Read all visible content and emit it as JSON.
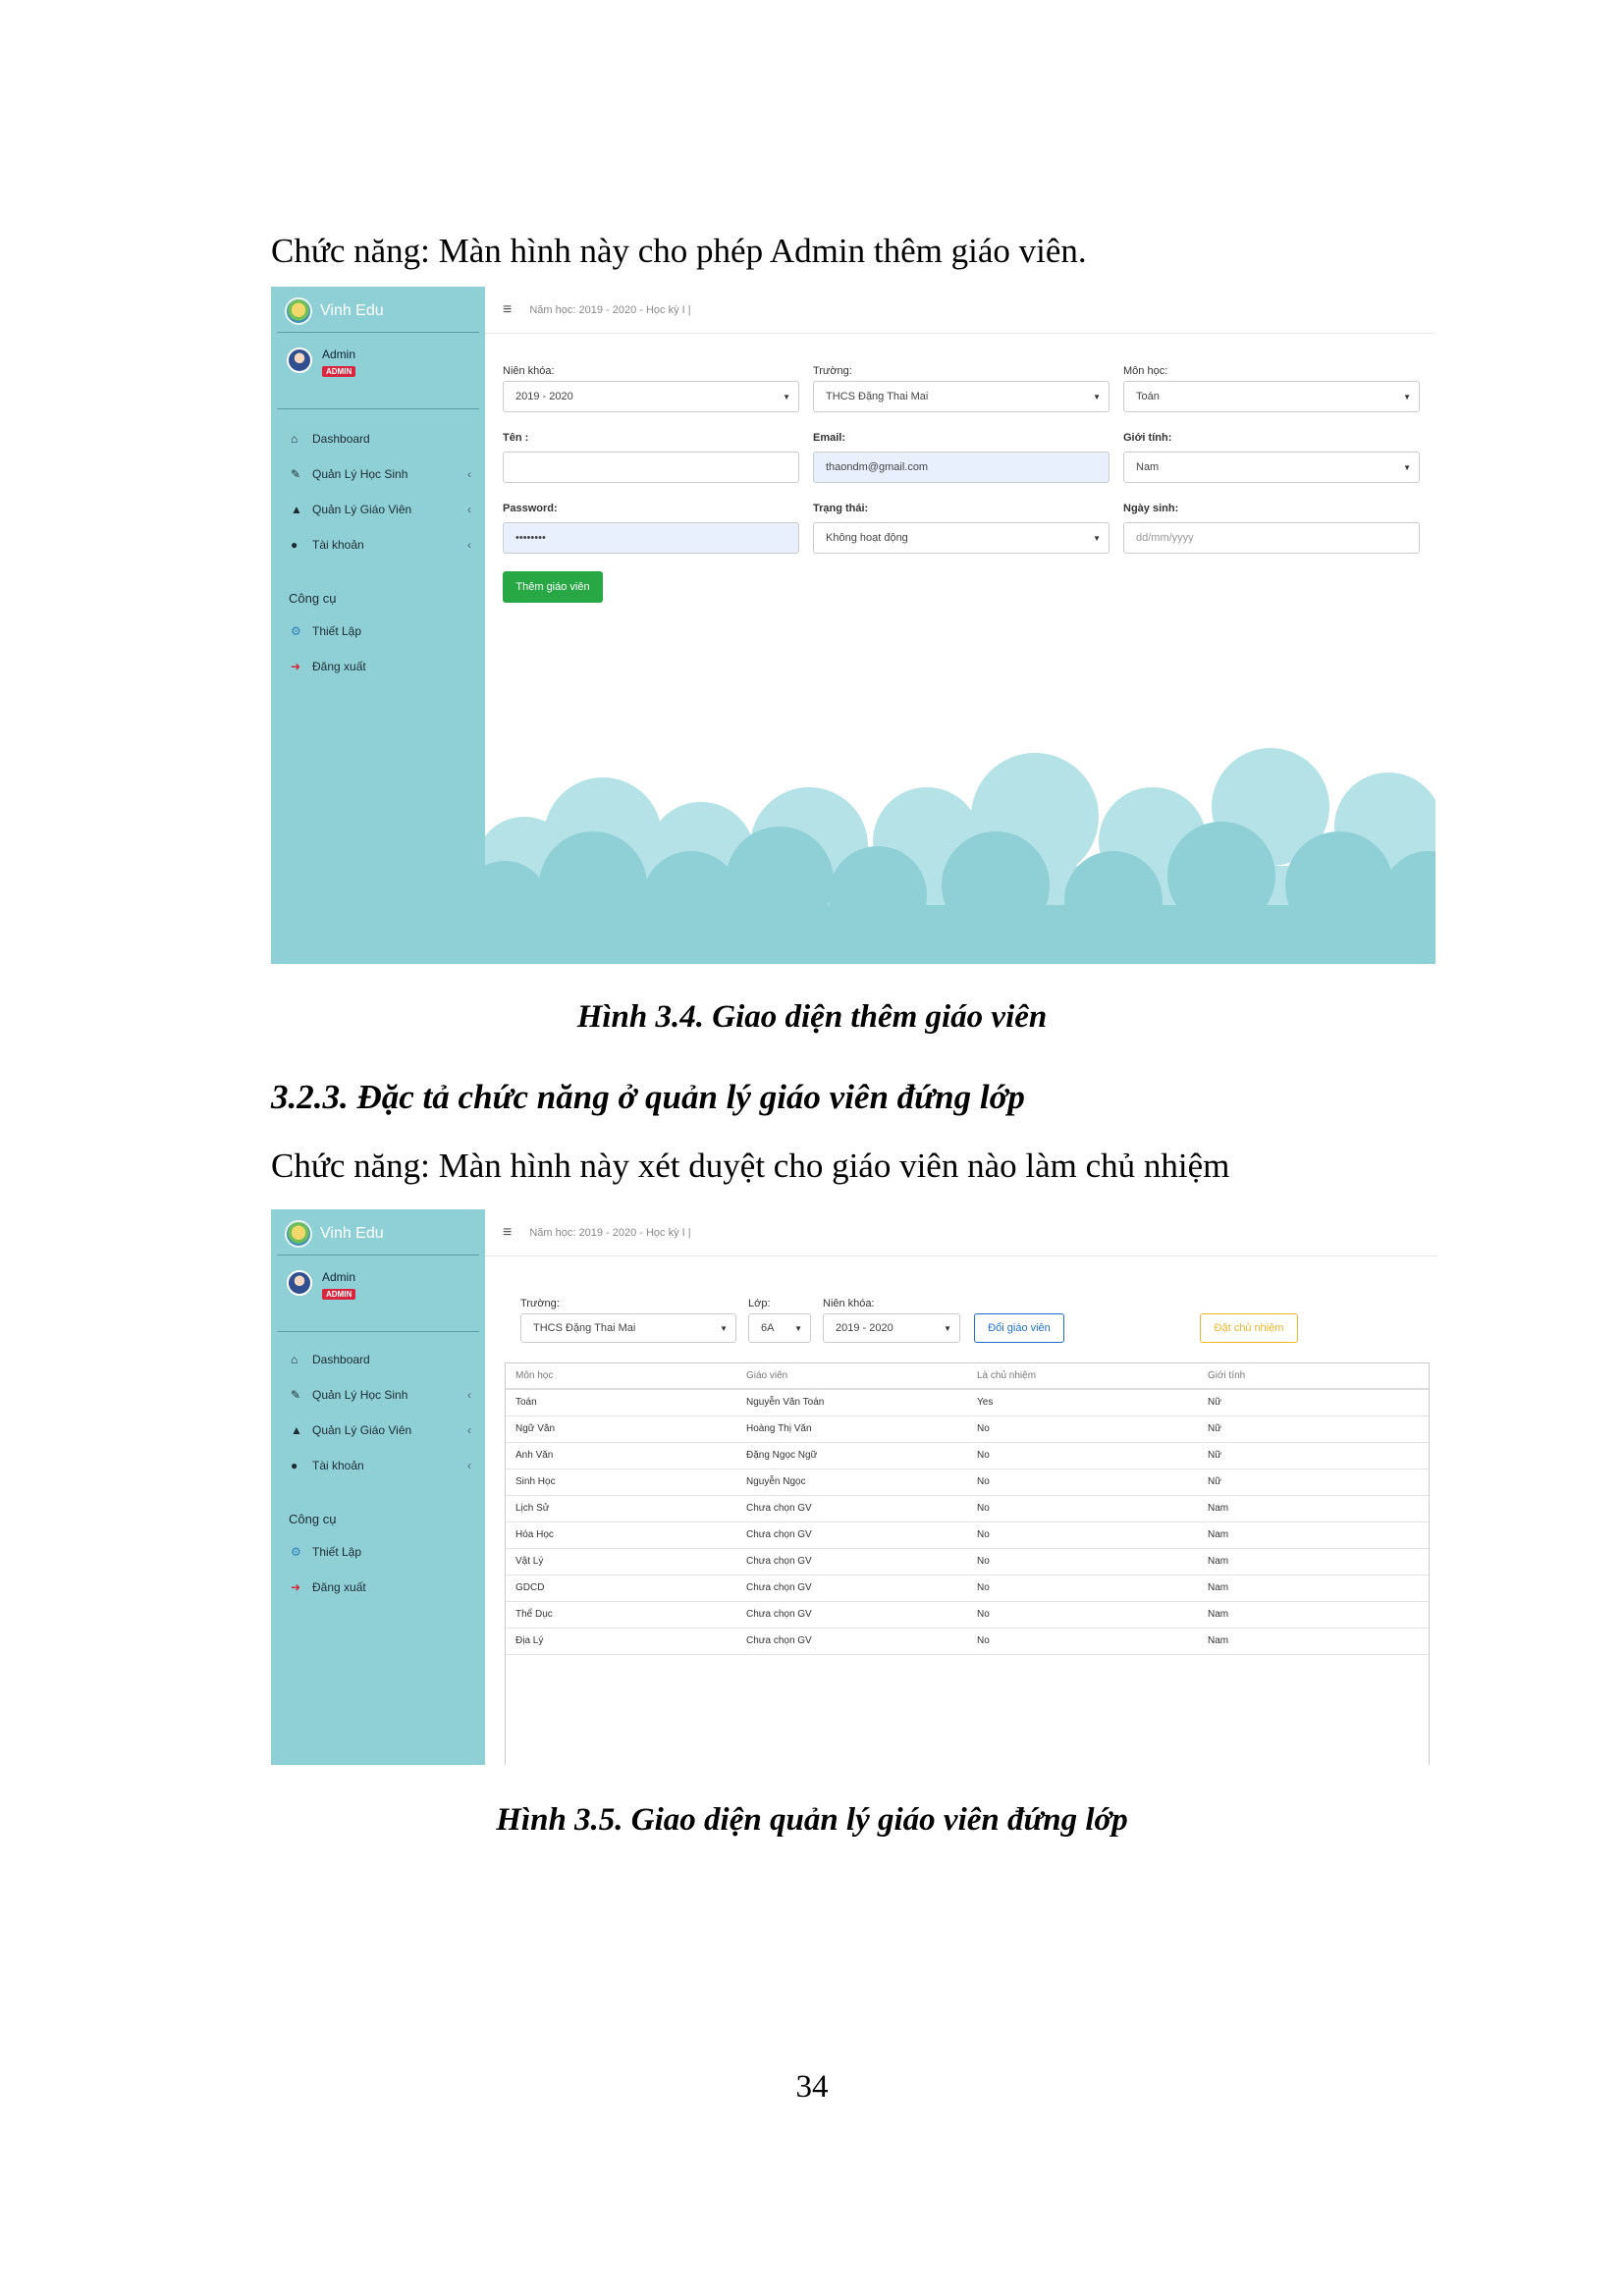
{
  "doc": {
    "para1": "Chức năng: Màn hình này cho phép Admin thêm giáo viên.",
    "caption1": "Hình 3.4. Giao diện thêm giáo viên",
    "heading": "3.2.3. Đặc tả chức năng ở quản lý giáo viên đứng lớp",
    "para2": "Chức năng: Màn hình này xét duyệt cho giáo viên nào làm chủ nhiệm",
    "caption2": "Hình 3.5. Giao diện quản lý giáo viên đứng lớp",
    "page_number": "34"
  },
  "app": {
    "brand": "Vinh Edu",
    "user": "Admin",
    "badge": "ADMIN",
    "year_text": "Năm học: 2019 - 2020 - Học kỳ I |",
    "menu": {
      "dashboard": "Dashboard",
      "students": "Quản Lý Học Sinh",
      "teachers": "Quản Lý Giáo Viên",
      "account": "Tài khoản",
      "tools_section": "Công cụ",
      "settings": "Thiết Lập",
      "logout": "Đăng xuất"
    },
    "icons": [
      "home-icon",
      "edit-icon",
      "graduation-cap-icon",
      "user-circle-icon",
      "gears-icon",
      "sign-out-icon"
    ]
  },
  "form1": {
    "nienkhoa_label": "Niên khóa:",
    "nienkhoa_value": "2019 - 2020",
    "truong_label": "Trường:",
    "truong_value": "THCS Đặng Thai Mai",
    "monhoc_label": "Môn học:",
    "monhoc_value": "Toán",
    "ten_label": "Tên :",
    "ten_value": "",
    "email_label": "Email:",
    "email_value": "thaondm@gmail.com",
    "gioitinh_label": "Giới tính:",
    "gioitinh_value": "Nam",
    "password_label": "Password:",
    "password_value": "••••••••",
    "trangthai_label": "Trạng thái:",
    "trangthai_value": "Không hoạt động",
    "ngaysinh_label": "Ngày sinh:",
    "ngaysinh_placeholder": "dd/mm/yyyy",
    "submit_label": "Thêm giáo viên"
  },
  "form2": {
    "truong_label": "Trường:",
    "truong_value": "THCS Đặng Thai Mai",
    "lop_label": "Lớp:",
    "lop_value": "6A",
    "nienkhoa_label": "Niên khóa:",
    "nienkhoa_value": "2019 - 2020",
    "change_btn": "Đổi giáo viên",
    "homeroom_btn": "Đặt chủ nhiệm",
    "columns": [
      "Môn học",
      "Giáo viên",
      "Là chủ nhiệm",
      "Giới tính"
    ],
    "rows": [
      [
        "Toán",
        "Nguyễn Văn Toán",
        "Yes",
        "Nữ"
      ],
      [
        "Ngữ Văn",
        "Hoàng Thị Văn",
        "No",
        "Nữ"
      ],
      [
        "Anh Văn",
        "Đặng Ngọc Ngữ",
        "No",
        "Nữ"
      ],
      [
        "Sinh Học",
        "Nguyễn Ngọc",
        "No",
        "Nữ"
      ],
      [
        "Lịch Sử",
        "Chưa chọn GV",
        "No",
        "Nam"
      ],
      [
        "Hóa Học",
        "Chưa chọn GV",
        "No",
        "Nam"
      ],
      [
        "Vật Lý",
        "Chưa chọn GV",
        "No",
        "Nam"
      ],
      [
        "GDCD",
        "Chưa chọn GV",
        "No",
        "Nam"
      ],
      [
        "Thể Dục",
        "Chưa chọn GV",
        "No",
        "Nam"
      ],
      [
        "Địa Lý",
        "Chưa chọn GV",
        "No",
        "Nam"
      ]
    ]
  },
  "colors": {
    "sidebar": "#8fd0d6",
    "cloud_dark": "#8fd0d6",
    "cloud_light": "#b4e2e7",
    "green_button": "#28a745",
    "blue_button": "#1f6fd1",
    "yellow_button": "#f0b429"
  }
}
